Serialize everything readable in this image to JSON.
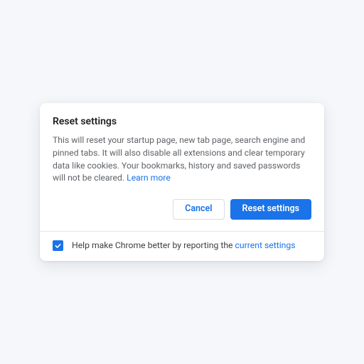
{
  "dialog": {
    "title": "Reset settings",
    "body_text": "This will reset your startup page, new tab page, search engine and pinned tabs. It will also disable all extensions and clear temporary data like cookies. Your bookmarks, history and saved passwords will not be cleared. ",
    "learn_more": "Learn more",
    "cancel_label": "Cancel",
    "confirm_label": "Reset settings"
  },
  "footer": {
    "checked": true,
    "text_prefix": "Help make Chrome better by reporting the ",
    "link_text": "current settings"
  },
  "colors": {
    "primary": "#1a73e8"
  }
}
